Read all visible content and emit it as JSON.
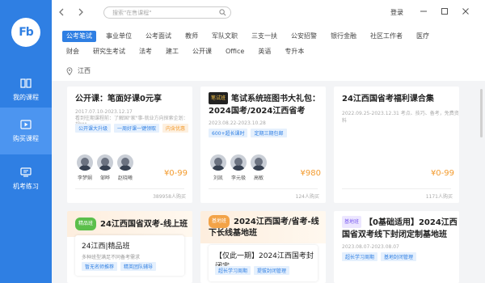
{
  "app": {
    "logo_text": "Fb"
  },
  "sidebar": {
    "items": [
      {
        "label": "我的课程",
        "icon": "book-icon",
        "active": false
      },
      {
        "label": "购买课程",
        "icon": "play-icon",
        "active": true
      },
      {
        "label": "机考练习",
        "icon": "monitor-icon",
        "active": false
      }
    ]
  },
  "topbar": {
    "search_placeholder": "搜索\"在售课程\"",
    "login_label": "登录"
  },
  "categories": {
    "row1": [
      "公考笔试",
      "事业单位",
      "公考面试",
      "教师",
      "军队文职",
      "三支一扶",
      "公安招警",
      "银行金融",
      "社区工作者",
      "医疗"
    ],
    "row2": [
      "财会",
      "研究生考试",
      "法考",
      "建工",
      "公开课",
      "Office",
      "英语",
      "专升本"
    ],
    "active": "公考笔试",
    "location": "江西"
  },
  "cards": [
    {
      "title": "公开课：笔面好课0元享",
      "date": "2017.07.10-2023.12.17",
      "desc": "看到往期课程前：了解国\"家\"事-就业方向探索企划：规\"\"\"",
      "tags": [
        "公开课大升级",
        "一周好课一键领取",
        "内含优惠"
      ],
      "teachers": [
        "李梦娴",
        "邹晔",
        "赵晓曦"
      ],
      "price": "¥0-99",
      "enrolled": "389958人购买"
    },
    {
      "badge": "笔试班",
      "title_line1": "笔试系统班图书大礼包：",
      "title_line2": "2024国考/2024江西省考",
      "date": "2023.08.22-2023.10.28",
      "tags": [
        "600+超长课时",
        "定期三期包邮"
      ],
      "teachers": [
        "刘凯",
        "李元极",
        "高敏"
      ],
      "price": "¥980",
      "enrolled": "124人购买"
    },
    {
      "title": "24江西国省考福利课合集",
      "date": "2022.09.25-2023.12.31",
      "desc": "考点、技巧、备考，免费资料",
      "price": "¥0-99",
      "enrolled": "1171人购买"
    },
    {
      "badge": "精品班",
      "title": "24江西国省双考-线上班",
      "inner_title": "24江西|精品班",
      "inner_desc": "多种班型满足不同备考需求",
      "tags": [
        "暂无名师推荐",
        "精英团队辅导"
      ]
    },
    {
      "badge": "基地班",
      "title_line1": "2024江西国考/省考-线",
      "title_line2": "下长线基地班",
      "inner_title": "【仅此一期】2024江西国考封闭定...",
      "tags": [
        "超长学习周期",
        "提拔封闭管理"
      ]
    },
    {
      "badge": "基地班",
      "title_line1": "【0基础适用】2024江西",
      "title_line2": "国省双考线下封闭定制基地班",
      "date": "2023.08.07-2023.08.07",
      "tags": [
        "超长学习周期",
        "基地封闭管理"
      ]
    }
  ]
}
